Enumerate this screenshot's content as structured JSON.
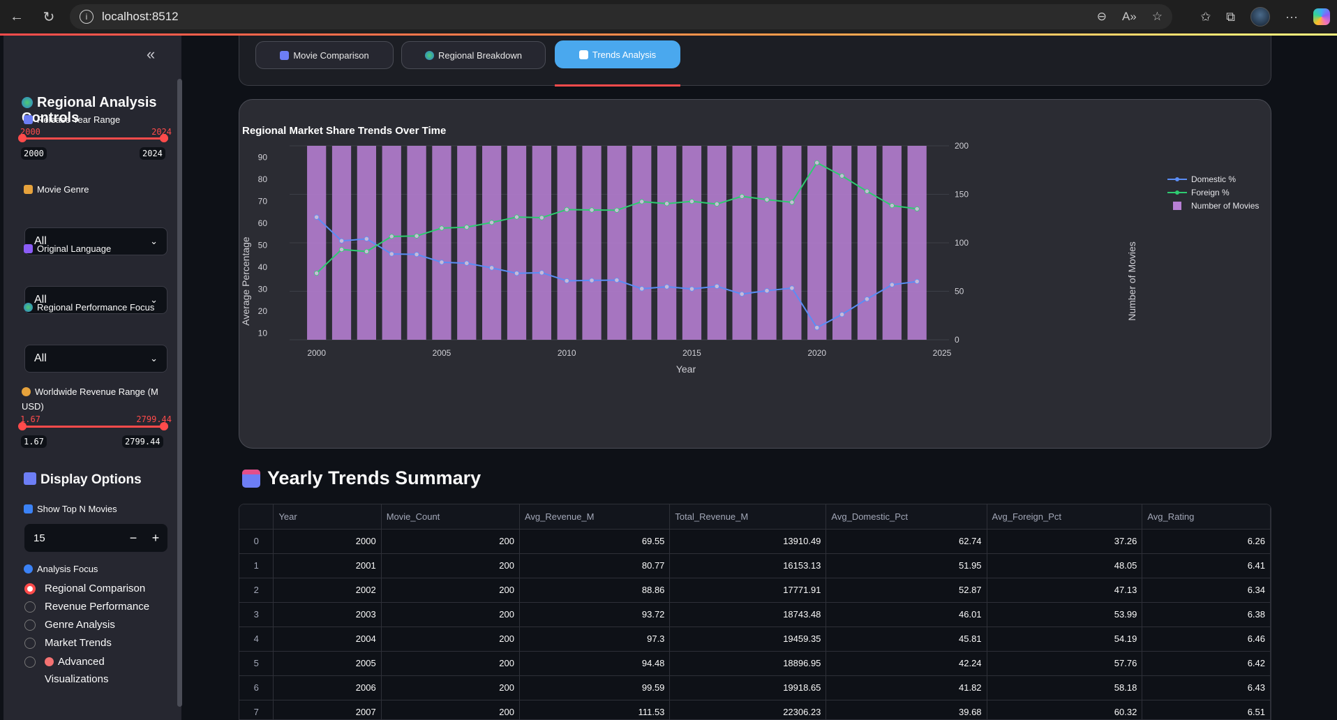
{
  "browser": {
    "url": "localhost:8512"
  },
  "sidebar": {
    "title": "Regional Analysis Controls",
    "release_year": {
      "label": "Release Year Range",
      "min": "2000",
      "max": "2024",
      "low": "2000",
      "high": "2024"
    },
    "genre": {
      "label": "Movie Genre",
      "value": "All"
    },
    "language": {
      "label": "Original Language",
      "value": "All"
    },
    "regional_focus": {
      "label": "Regional Performance Focus",
      "value": "All"
    },
    "revenue": {
      "label": "Worldwide Revenue Range (M USD)",
      "min": "1.67",
      "max": "2799.44",
      "low": "1.67",
      "high": "2799.44"
    },
    "display_title": "Display Options",
    "top_n": {
      "label": "Show Top N Movies",
      "value": "15",
      "minus": "−",
      "plus": "+"
    },
    "analysis_focus": {
      "label": "Analysis Focus",
      "options": [
        "Regional Comparison",
        "Revenue Performance",
        "Genre Analysis",
        "Market Trends",
        "Advanced Visualizations"
      ],
      "selected": "Regional Comparison"
    }
  },
  "tabs": [
    {
      "label": "Movie Comparison",
      "icon": "bar-chart-icon"
    },
    {
      "label": "Regional Breakdown",
      "icon": "globe-icon"
    },
    {
      "label": "Trends Analysis",
      "icon": "trend-icon",
      "active": true
    }
  ],
  "chart_data": {
    "type": "bar+line",
    "title": "Regional Market Share Trends Over Time",
    "xlabel": "Year",
    "ylabel": "Average Percentage",
    "y2label": "Number of Movies",
    "x": [
      2000,
      2001,
      2002,
      2003,
      2004,
      2005,
      2006,
      2007,
      2008,
      2009,
      2010,
      2011,
      2012,
      2013,
      2014,
      2015,
      2016,
      2017,
      2018,
      2019,
      2020,
      2021,
      2022,
      2023,
      2024
    ],
    "x_ticks": [
      "2000",
      "2005",
      "2010",
      "2015",
      "2020",
      "2025"
    ],
    "y_ticks": [
      "10",
      "20",
      "30",
      "40",
      "50",
      "60",
      "70",
      "80",
      "90"
    ],
    "y2_ticks": [
      "0",
      "50",
      "100",
      "150",
      "200"
    ],
    "ylim": [
      7,
      92
    ],
    "y2lim": [
      0,
      200
    ],
    "xlim": [
      1999.2,
      2025
    ],
    "legend_position": "top-right",
    "series": [
      {
        "name": "Domestic %",
        "type": "line",
        "color": "#5b8df5",
        "values": [
          62.74,
          51.95,
          52.87,
          46.01,
          45.81,
          42.24,
          41.82,
          39.68,
          37.2,
          37.5,
          33.8,
          34.0,
          34.1,
          30.2,
          31.1,
          30.1,
          31.3,
          27.8,
          29.3,
          30.5,
          12.5,
          18.5,
          25.5,
          32.0,
          33.5
        ]
      },
      {
        "name": "Foreign %",
        "type": "line",
        "color": "#2ecc71",
        "values": [
          37.26,
          48.05,
          47.13,
          53.99,
          54.19,
          57.76,
          58.18,
          60.32,
          62.8,
          62.5,
          66.2,
          66.0,
          65.9,
          69.8,
          68.9,
          69.9,
          68.7,
          72.2,
          70.7,
          69.5,
          87.5,
          81.5,
          74.5,
          68.0,
          66.5
        ]
      },
      {
        "name": "Number of Movies",
        "type": "bar",
        "axis": "y2",
        "color": "#b77fd4",
        "values": [
          200,
          200,
          200,
          200,
          200,
          200,
          200,
          200,
          200,
          200,
          200,
          200,
          200,
          200,
          200,
          200,
          200,
          200,
          200,
          200,
          200,
          200,
          200,
          200,
          200
        ]
      }
    ]
  },
  "summary": {
    "title": "Yearly Trends Summary",
    "columns": [
      "",
      "Year",
      "Movie_Count",
      "Avg_Revenue_M",
      "Total_Revenue_M",
      "Avg_Domestic_Pct",
      "Avg_Foreign_Pct",
      "Avg_Rating"
    ],
    "rows": [
      [
        "0",
        "2000",
        "200",
        "69.55",
        "13910.49",
        "62.74",
        "37.26",
        "6.26"
      ],
      [
        "1",
        "2001",
        "200",
        "80.77",
        "16153.13",
        "51.95",
        "48.05",
        "6.41"
      ],
      [
        "2",
        "2002",
        "200",
        "88.86",
        "17771.91",
        "52.87",
        "47.13",
        "6.34"
      ],
      [
        "3",
        "2003",
        "200",
        "93.72",
        "18743.48",
        "46.01",
        "53.99",
        "6.38"
      ],
      [
        "4",
        "2004",
        "200",
        "97.3",
        "19459.35",
        "45.81",
        "54.19",
        "6.46"
      ],
      [
        "5",
        "2005",
        "200",
        "94.48",
        "18896.95",
        "42.24",
        "57.76",
        "6.42"
      ],
      [
        "6",
        "2006",
        "200",
        "99.59",
        "19918.65",
        "41.82",
        "58.18",
        "6.43"
      ],
      [
        "7",
        "2007",
        "200",
        "111.53",
        "22306.23",
        "39.68",
        "60.32",
        "6.51"
      ]
    ]
  }
}
